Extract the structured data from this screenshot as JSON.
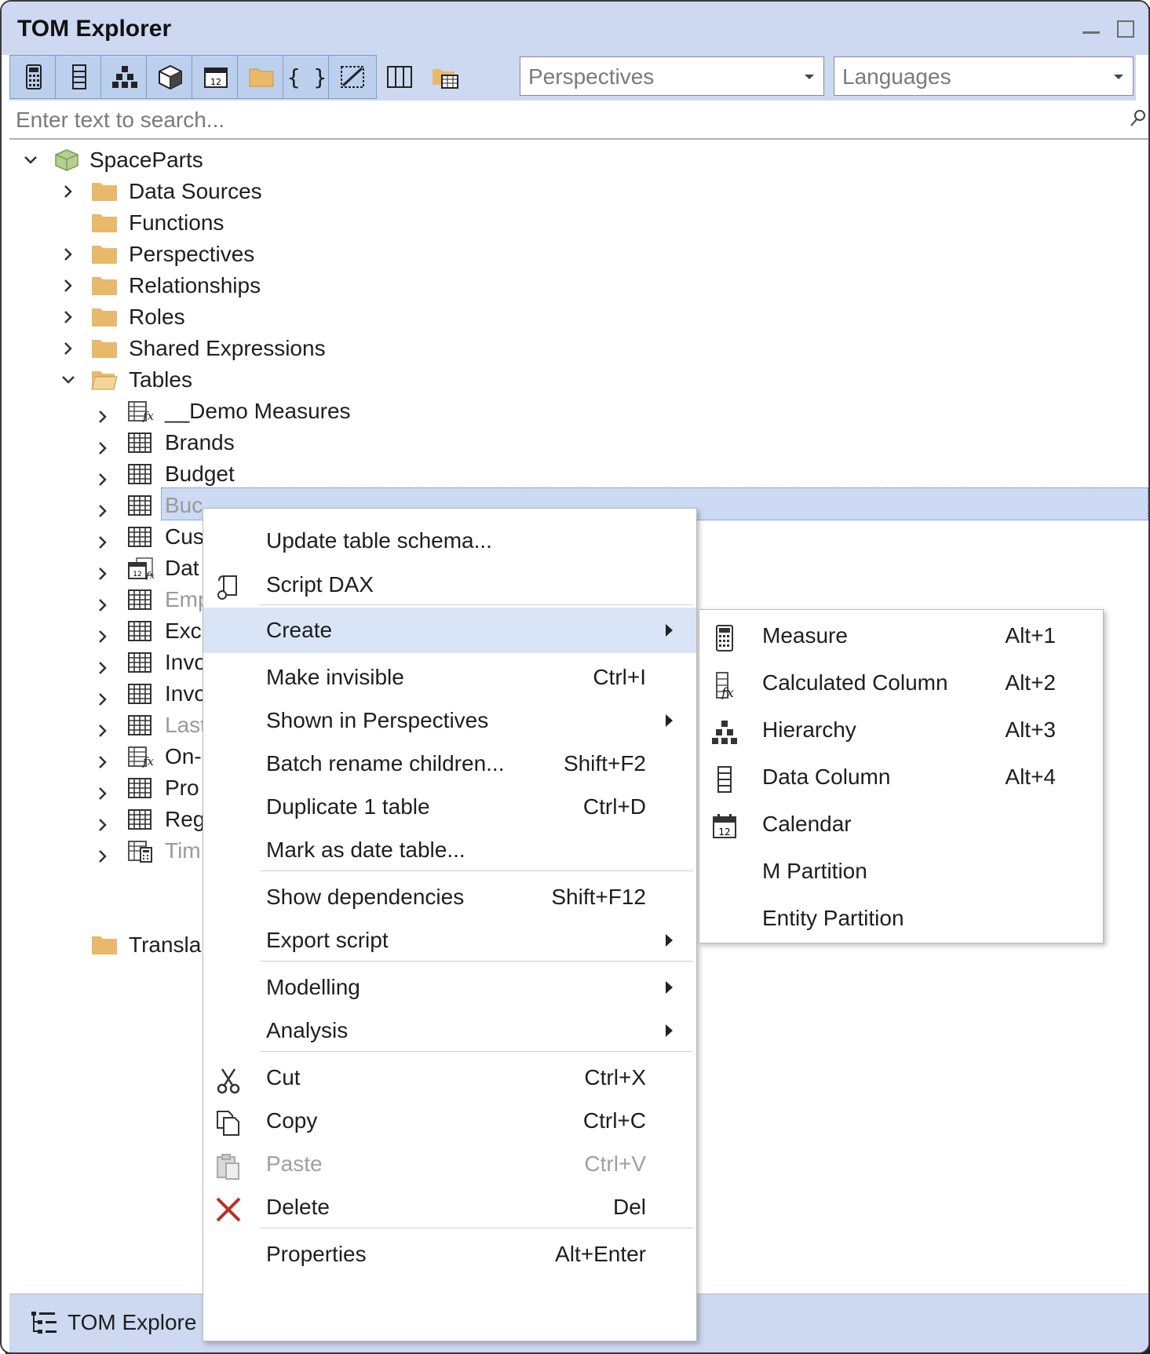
{
  "window": {
    "title": "TOM Explorer"
  },
  "toolbar": {
    "buttons": [
      "calculator-icon",
      "data-column-icon",
      "hierarchy-icon",
      "model-cube-icon",
      "calendar-icon",
      "folder-icon",
      "braces-icon",
      "edit-diagonal-icon",
      "columns-icon",
      "folder-table-icon"
    ],
    "perspectives": "Perspectives",
    "languages": "Languages"
  },
  "search": {
    "placeholder": "Enter text to search..."
  },
  "tree": {
    "root": "SpaceParts",
    "folders": [
      "Data Sources",
      "Functions",
      "Perspectives",
      "Relationships",
      "Roles",
      "Shared Expressions",
      "Tables"
    ],
    "tables": [
      {
        "label": "__Demo Measures",
        "icon": "measure-table-icon"
      },
      {
        "label": "Brands",
        "icon": "table-icon"
      },
      {
        "label": "Budget",
        "icon": "table-icon",
        "selected": true
      },
      {
        "label": "Buc",
        "icon": "table-icon",
        "hidden": true
      },
      {
        "label": "Cus",
        "icon": "table-icon"
      },
      {
        "label": "Dat",
        "icon": "date-table-icon"
      },
      {
        "label": "Emp",
        "icon": "table-icon",
        "hidden": true
      },
      {
        "label": "Exc",
        "icon": "table-icon"
      },
      {
        "label": "Invo",
        "icon": "table-icon"
      },
      {
        "label": "Invo",
        "icon": "table-icon"
      },
      {
        "label": "Last",
        "icon": "table-icon",
        "hidden": true
      },
      {
        "label": "On-",
        "icon": "measure-table-icon"
      },
      {
        "label": "Pro",
        "icon": "table-icon"
      },
      {
        "label": "Reg",
        "icon": "table-icon"
      },
      {
        "label": "Tim",
        "icon": "calc-group-icon",
        "hidden": true
      }
    ],
    "after_tables": "Transla"
  },
  "bottom_tab": {
    "label": "TOM Explore"
  },
  "context_menu": {
    "items": [
      {
        "label": "Update table schema...",
        "shortcut": ""
      },
      {
        "label": "Script DAX",
        "shortcut": "",
        "icon": "script-icon"
      },
      {
        "label": "Create",
        "submenu": true,
        "highlighted": true
      },
      {
        "label": "Make invisible",
        "shortcut": "Ctrl+I"
      },
      {
        "label": "Shown in Perspectives",
        "submenu": true
      },
      {
        "label": "Batch rename children...",
        "shortcut": "Shift+F2"
      },
      {
        "label": "Duplicate 1 table",
        "shortcut": "Ctrl+D"
      },
      {
        "label": "Mark as date table...",
        "shortcut": ""
      },
      {
        "label": "Show dependencies",
        "shortcut": "Shift+F12"
      },
      {
        "label": "Export script",
        "submenu": true
      },
      {
        "label": "Modelling",
        "submenu": true
      },
      {
        "label": "Analysis",
        "submenu": true
      },
      {
        "label": "Cut",
        "shortcut": "Ctrl+X",
        "icon": "scissors-icon"
      },
      {
        "label": "Copy",
        "shortcut": "Ctrl+C",
        "icon": "copy-icon"
      },
      {
        "label": "Paste",
        "shortcut": "Ctrl+V",
        "icon": "paste-icon",
        "disabled": true
      },
      {
        "label": "Delete",
        "shortcut": "Del",
        "icon": "delete-icon"
      },
      {
        "label": "Properties",
        "shortcut": "Alt+Enter"
      }
    ]
  },
  "create_submenu": {
    "items": [
      {
        "label": "Measure",
        "shortcut": "Alt+1",
        "icon": "calculator-icon"
      },
      {
        "label": "Calculated Column",
        "shortcut": "Alt+2",
        "icon": "calculated-column-icon"
      },
      {
        "label": "Hierarchy",
        "shortcut": "Alt+3",
        "icon": "hierarchy-icon"
      },
      {
        "label": "Data Column",
        "shortcut": "Alt+4",
        "icon": "data-column-icon"
      },
      {
        "label": "Calendar",
        "shortcut": "",
        "icon": "calendar-icon"
      },
      {
        "label": "M Partition",
        "shortcut": ""
      },
      {
        "label": "Entity Partition",
        "shortcut": ""
      }
    ]
  },
  "colors": {
    "titlebar": "#ccd9f1",
    "selection": "#ccdaf3",
    "folder": "#e8b96a",
    "delete": "#c42b1c"
  }
}
